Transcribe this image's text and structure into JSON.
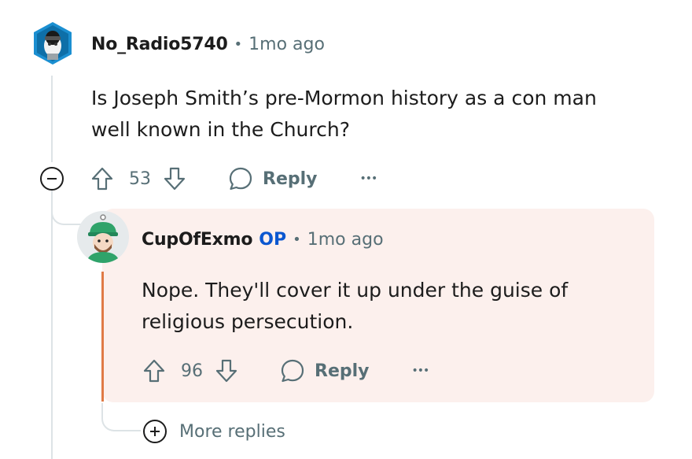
{
  "comment": {
    "username": "No_Radio5740",
    "separator": "•",
    "timestamp": "1mo ago",
    "body_lines": [
      "Is Joseph Smith’s pre-Mormon history as a con man",
      "well known in the Church?"
    ],
    "score": "53",
    "reply_label": "Reply",
    "overflow_label": "•••"
  },
  "reply": {
    "username": "CupOfExmo",
    "op_badge": "OP",
    "separator": "•",
    "timestamp": "1mo ago",
    "body_lines": [
      "Nope. They'll cover it up under the guise of",
      "religious persecution."
    ],
    "score": "96",
    "reply_label": "Reply",
    "overflow_label": "•••"
  },
  "more_replies_label": "More replies",
  "colors": {
    "highlight_bg": "#fcf0ed",
    "op_accent": "#0b57d0",
    "thread_line": "#dde3e6",
    "reply_bar": "#e07a46"
  }
}
